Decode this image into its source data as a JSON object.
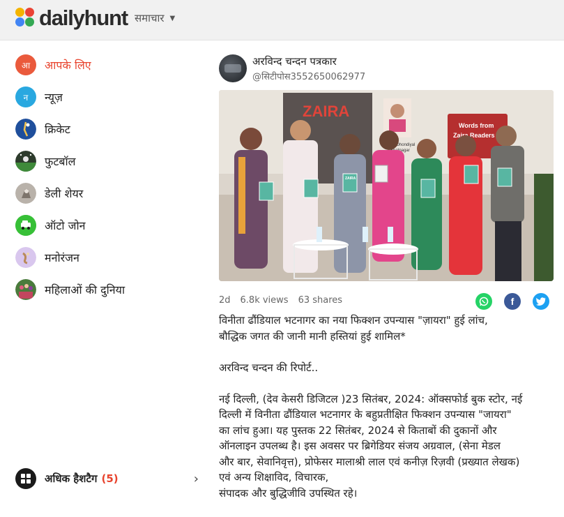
{
  "header": {
    "logo_text": "dailyhunt",
    "nav_label": "समाचार"
  },
  "sidebar": {
    "items": [
      {
        "label": "आपके लिए",
        "icon_text": "आ",
        "icon": "home-avatar-icon",
        "color": "#ea5a3c"
      },
      {
        "label": "न्यूज़",
        "icon_text": "न",
        "icon": "news-avatar-icon",
        "color": "#29a8e0"
      },
      {
        "label": "क्रिकेट",
        "icon": "cricket-icon"
      },
      {
        "label": "फुटबॉल",
        "icon": "football-icon"
      },
      {
        "label": "डेली शेयर",
        "icon": "daily-share-icon"
      },
      {
        "label": "ऑटो जोन",
        "icon": "auto-zone-icon"
      },
      {
        "label": "मनोरंजन",
        "icon": "entertainment-icon"
      },
      {
        "label": "महिलाओं की दुनिया",
        "icon": "women-world-icon"
      }
    ],
    "more": {
      "label": "अधिक हैशटैग",
      "count": "(5)"
    }
  },
  "article": {
    "author_name": "अरविन्द चन्दन पत्रकार",
    "author_handle": "@सिटीपोस3552650062977",
    "photo": {
      "banner_title": "ZAIRA",
      "sign_line1": "Words from",
      "sign_line2": "Zaira Readers",
      "poster_line1": "Vinita Dhondiyal",
      "poster_line2": "Bhatnagar",
      "book_label": "ZAIRA"
    },
    "age": "2d",
    "views": "6.8k views",
    "shares": "63 shares",
    "headline1": "विनीता ढौंडियाल भटनागर का नया फिक्शन उपन्यास \"ज़ायरा\" हुई लांच,",
    "headline2": "बौद्धिक जगत की जानी मानी हस्तियां हुई शामिल*",
    "byline": "अरविन्द चन्दन की रिपोर्ट..",
    "para1_l1": "नई दिल्ली, (देव केसरी डिजिटल )23 सितंबर, 2024: ऑक्सफोर्ड बुक स्टोर, नई",
    "para1_l2": "दिल्ली में विनीता ढौंडियाल भटनागर के बहुप्रतीक्षित फिक्शन उपन्यास \"जायरा\"",
    "para1_l3": "का लांच हुआ। यह पुस्तक 22 सितंबर, 2024 से किताबों की दुकानों और",
    "para1_l4": "ऑनलाइन उपलब्ध है। इस अवसर पर ब्रिगेडियर संजय अग्रवाल, (सेना मेडल",
    "para1_l5": "और बार, सेवानिवृत्त), प्रोफेसर मालाश्री लाल एवं कनीज़ रिज़वी (प्रख्यात लेखक)",
    "para1_l6": "एवं अन्य शिक्षाविद, विचारक,",
    "para1_l7": "संपादक और बुद्धिजीवि उपस्थित रहे।"
  },
  "colors": {
    "accent": "#e8432d",
    "whatsapp": "#25d366",
    "facebook": "#3b5998",
    "twitter": "#1da1f2"
  }
}
